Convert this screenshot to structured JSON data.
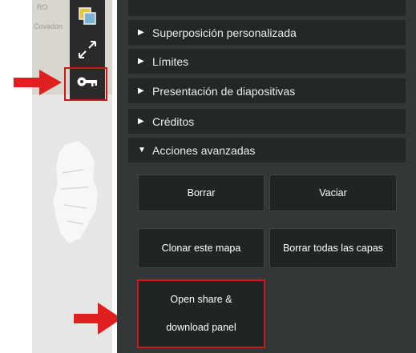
{
  "map": {
    "label_top": "RO",
    "label_side": "Covadon"
  },
  "toolbar": {
    "tools": [
      {
        "icon": "layers-icon"
      },
      {
        "icon": "arrows-icon"
      },
      {
        "icon": "key-icon"
      }
    ]
  },
  "sections": [
    {
      "label": "Superposición personalizada",
      "expanded": false
    },
    {
      "label": "Límites",
      "expanded": false
    },
    {
      "label": "Presentación de diapositivas",
      "expanded": false
    },
    {
      "label": "Créditos",
      "expanded": false
    },
    {
      "label": "Acciones avanzadas",
      "expanded": true
    }
  ],
  "actions": {
    "delete": "Borrar",
    "empty": "Vaciar",
    "clone": "Clonar este mapa",
    "delete_layers": "Borrar todas las capas",
    "share_line1": "Open share &",
    "share_line2": "download panel"
  },
  "colors": {
    "highlight": "#d01515",
    "panel": "#323737",
    "section": "#232727"
  }
}
